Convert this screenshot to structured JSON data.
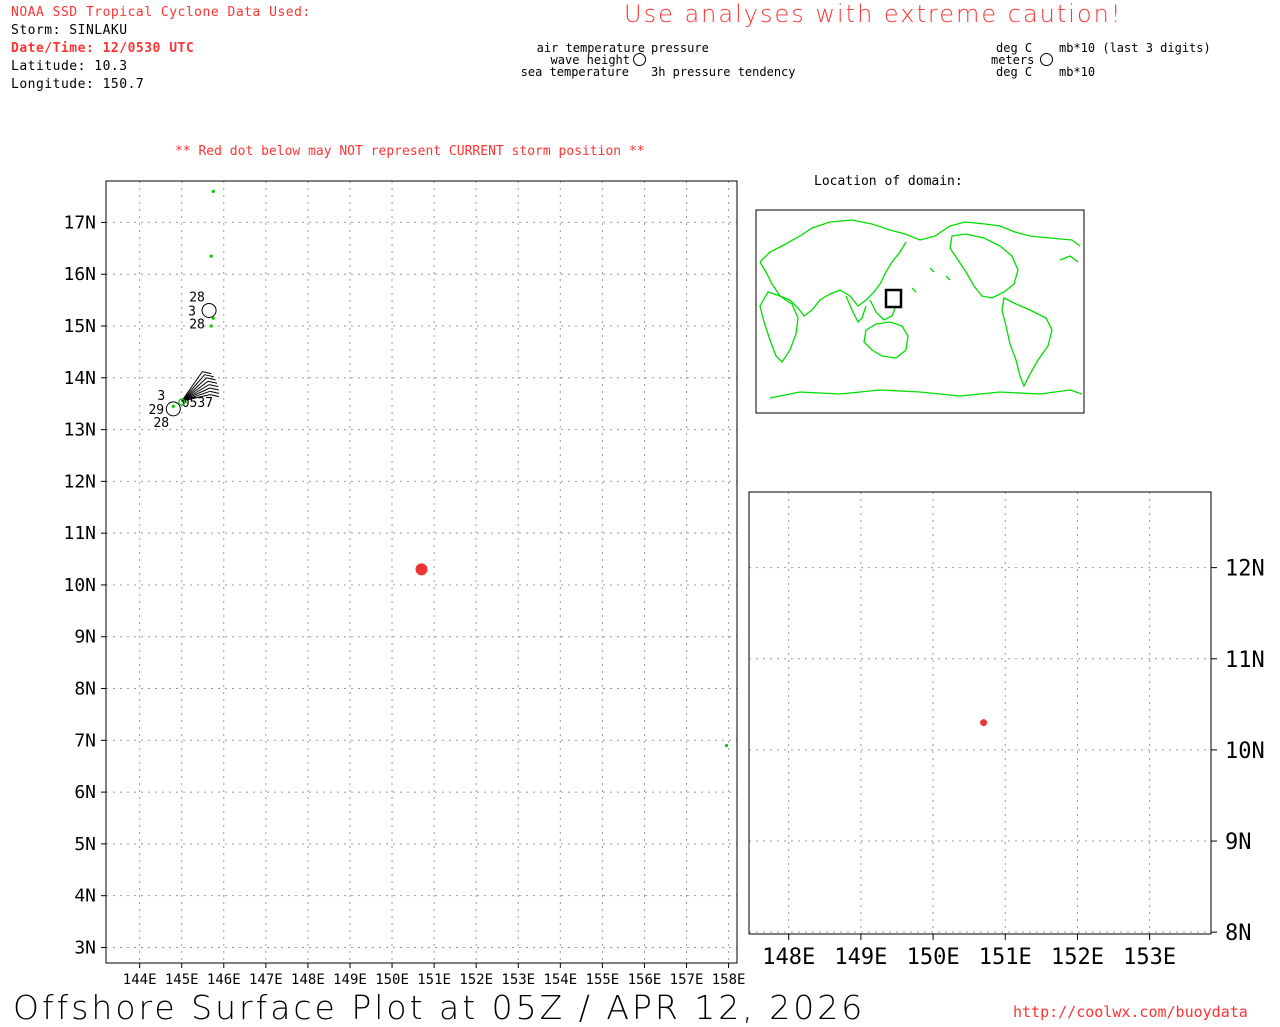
{
  "header": {
    "source_line": "NOAA SSD Tropical Cyclone Data Used:",
    "storm_line": "Storm: SINLAKU",
    "datetime_line": "Date/Time: 12/0530 UTC",
    "latitude_line": "Latitude: 10.3",
    "longitude_line": "Longitude: 150.7",
    "caution": "Use analyses with extreme caution!",
    "red_dot_note": "** Red dot below may NOT represent CURRENT storm position **"
  },
  "legend": {
    "air_temperature": "air temperature",
    "wave_height": "wave height",
    "sea_temperature": "sea temperature",
    "pressure": "pressure",
    "pressure_tendency": "3h pressure tendency",
    "deg_c_top": "deg C",
    "meters": "meters",
    "deg_c_bottom": "deg C",
    "mb_top": "mb*10 (last 3 digits)",
    "mb_bottom": "mb*10"
  },
  "inset": {
    "title": "Location of domain:"
  },
  "footer": {
    "plot_title": "Offshore Surface Plot at 05Z / APR 12, 2026",
    "url": "http://coolwx.com/buoydata"
  },
  "colors": {
    "storm_dot": "#ee3333",
    "coast": "#00dd00",
    "grid": "#999999",
    "caution": "#ff3333"
  },
  "chart_data": [
    {
      "type": "scatter",
      "name": "main-map",
      "x_ticks": [
        "144E",
        "145E",
        "146E",
        "147E",
        "148E",
        "149E",
        "150E",
        "151E",
        "152E",
        "153E",
        "154E",
        "155E",
        "156E",
        "157E",
        "158E"
      ],
      "y_ticks": [
        "3N",
        "4N",
        "5N",
        "6N",
        "7N",
        "8N",
        "9N",
        "10N",
        "11N",
        "12N",
        "13N",
        "14N",
        "15N",
        "16N",
        "17N"
      ],
      "xlim": [
        143.2,
        158.2
      ],
      "ylim": [
        2.7,
        17.8
      ],
      "grid": true,
      "storm_position": {
        "lon": 150.7,
        "lat": 10.3
      },
      "stations": [
        {
          "lon": 145.65,
          "lat": 15.3,
          "label_top": "28",
          "label_left": "3",
          "label_bottom": "28"
        },
        {
          "lon": 144.8,
          "lat": 13.4,
          "label_top": "3",
          "label_left": "29",
          "label_bottom": "28"
        }
      ],
      "station_cluster_label": "0537"
    },
    {
      "type": "scatter",
      "name": "zoom-map",
      "x_ticks": [
        "148E",
        "149E",
        "150E",
        "151E",
        "152E",
        "153E"
      ],
      "y_ticks": [
        "8N",
        "9N",
        "10N",
        "11N",
        "12N"
      ],
      "xlim": [
        147.45,
        153.85
      ],
      "ylim": [
        7.98,
        12.83
      ],
      "grid": true,
      "storm_position": {
        "lon": 150.7,
        "lat": 10.3
      }
    }
  ]
}
